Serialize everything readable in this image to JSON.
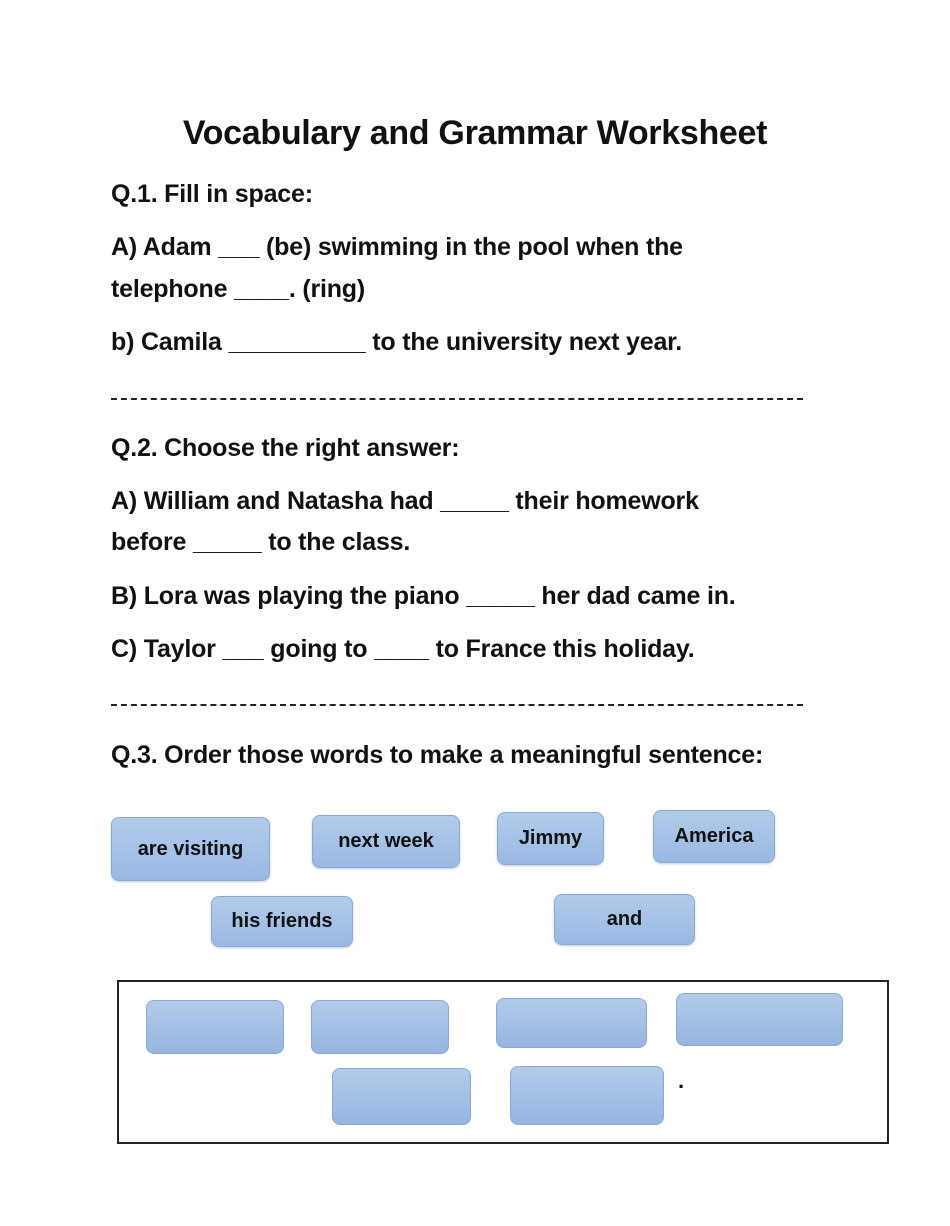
{
  "title": "Vocabulary and Grammar Worksheet",
  "q1": {
    "heading": "Q.1. Fill in space:",
    "items": [
      {
        "line1": "A) Adam ___ (be) swimming in the pool when the",
        "line2": "telephone ____. (ring)"
      },
      {
        "line1": "b) Camila __________ to the university next year."
      }
    ]
  },
  "separator": "-----------------------------------------------------------------------",
  "q2": {
    "heading": "Q.2. Choose the right answer:",
    "items": [
      {
        "line1": "A) William and Natasha had _____ their homework",
        "line2": "before _____ to the class."
      },
      {
        "line1": "B) Lora was playing the piano _____ her dad came in."
      },
      {
        "line1": "C) Taylor ___ going to ____ to France this holiday."
      }
    ]
  },
  "q3": {
    "heading": "Q.3. Order those words to make a meaningful sentence:",
    "words": [
      "are visiting",
      "next week",
      "Jimmy",
      "America",
      "his friends",
      "and"
    ],
    "answer_slot_count": 6,
    "end_punctuation": "."
  },
  "colors": {
    "chip_top": "#b3cbe9",
    "chip_bottom": "#99b9e3",
    "chip_border": "#8aaad6"
  }
}
